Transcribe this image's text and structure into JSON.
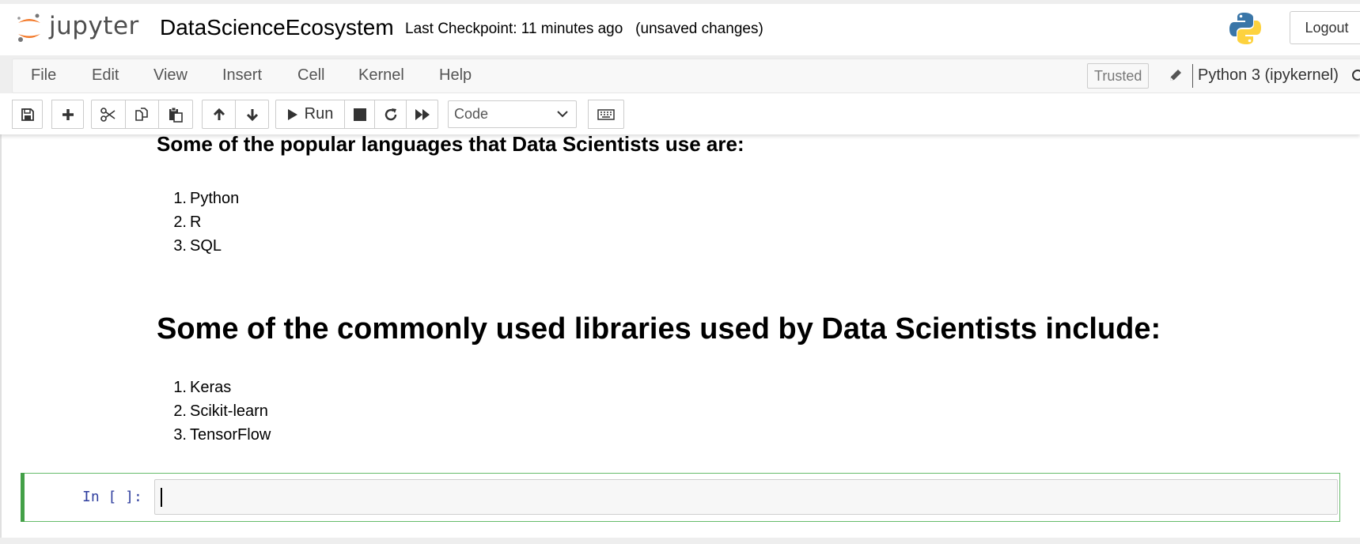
{
  "header": {
    "logo_text": "jupyter",
    "notebook_name": "DataScienceEcosystem",
    "checkpoint": "Last Checkpoint: 11 minutes ago",
    "unsaved": "(unsaved changes)",
    "logout_label": "Logout"
  },
  "menubar": {
    "items": [
      "File",
      "Edit",
      "View",
      "Insert",
      "Cell",
      "Kernel",
      "Help"
    ],
    "trusted_label": "Trusted",
    "kernel_name": "Python 3 (ipykernel)"
  },
  "toolbar": {
    "run_label": "Run",
    "cell_type": "Code",
    "icons": [
      "save-icon",
      "plus-icon",
      "cut-icon",
      "copy-icon",
      "paste-icon",
      "arrow-up-icon",
      "arrow-down-icon",
      "run-icon",
      "stop-icon",
      "restart-icon",
      "fast-forward-icon",
      "keyboard-icon"
    ]
  },
  "cells": {
    "languages_heading": "Some of the popular languages that Data Scientists use are:",
    "languages": [
      {
        "num": "1.",
        "text": "Python"
      },
      {
        "num": "2.",
        "text": "R"
      },
      {
        "num": "3.",
        "text": "SQL"
      }
    ],
    "libraries_heading": "Some of the commonly used libraries used by Data Scientists include:",
    "libraries": [
      {
        "num": "1.",
        "text": "Keras"
      },
      {
        "num": "2.",
        "text": "Scikit-learn"
      },
      {
        "num": "3.",
        "text": "TensorFlow"
      }
    ],
    "code_prompt": "In [ ]:",
    "code_value": ""
  },
  "colors": {
    "logo_orange": "#f37726",
    "logo_gray": "#767677",
    "selected_cell_border": "#66bb6a",
    "prompt_blue": "#303f9f"
  }
}
